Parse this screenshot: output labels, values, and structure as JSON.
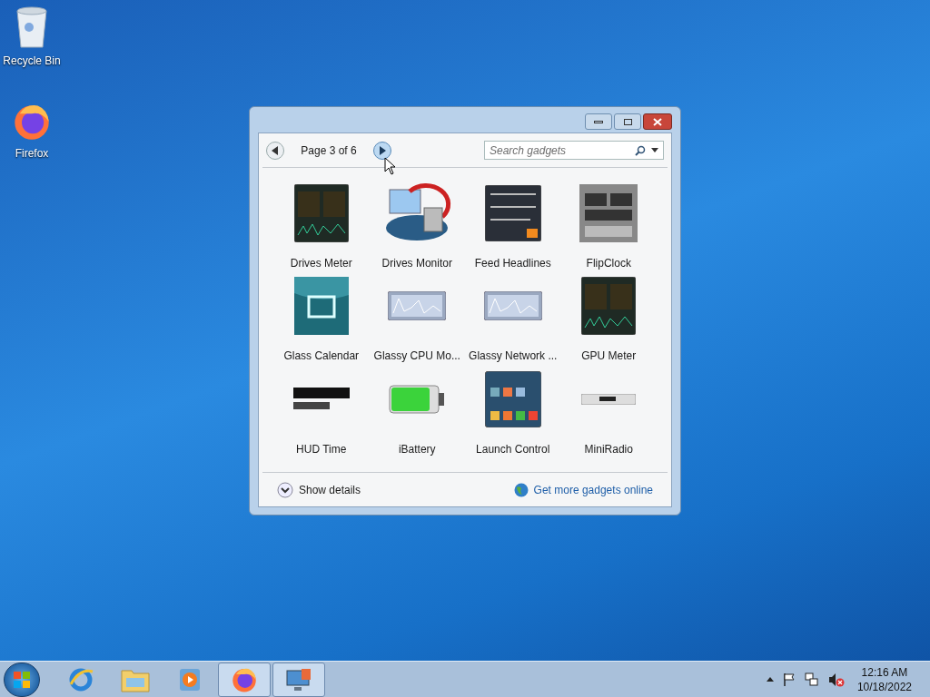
{
  "desktop_icons": [
    {
      "label": "Recycle Bin",
      "kind": "recycle"
    },
    {
      "label": "Firefox",
      "kind": "firefox"
    }
  ],
  "gadget_window": {
    "pager": "Page 3 of 6",
    "search": {
      "placeholder": "Search gadgets"
    },
    "gadgets": [
      {
        "name": "Drives Meter",
        "kind": "meter"
      },
      {
        "name": "Drives Monitor",
        "kind": "disk"
      },
      {
        "name": "Feed Headlines",
        "kind": "feed"
      },
      {
        "name": "FlipClock",
        "kind": "flip"
      },
      {
        "name": "Glass Calendar",
        "kind": "calendar"
      },
      {
        "name": "Glassy CPU Mo...",
        "kind": "graph"
      },
      {
        "name": "Glassy Network ...",
        "kind": "graph"
      },
      {
        "name": "GPU Meter",
        "kind": "meter"
      },
      {
        "name": "HUD Time",
        "kind": "clock"
      },
      {
        "name": "iBattery",
        "kind": "battery"
      },
      {
        "name": "Launch Control",
        "kind": "launch"
      },
      {
        "name": "MiniRadio",
        "kind": "radio"
      }
    ],
    "details": "Show details",
    "link": "Get more gadgets online"
  },
  "taskbar": {
    "items": [
      {
        "kind": "ie",
        "active": false
      },
      {
        "kind": "folder",
        "active": false
      },
      {
        "kind": "media",
        "active": false
      },
      {
        "kind": "firefox",
        "active": true
      },
      {
        "kind": "gadgets",
        "active": true
      }
    ],
    "time": "12:16 AM",
    "date": "10/18/2022"
  }
}
